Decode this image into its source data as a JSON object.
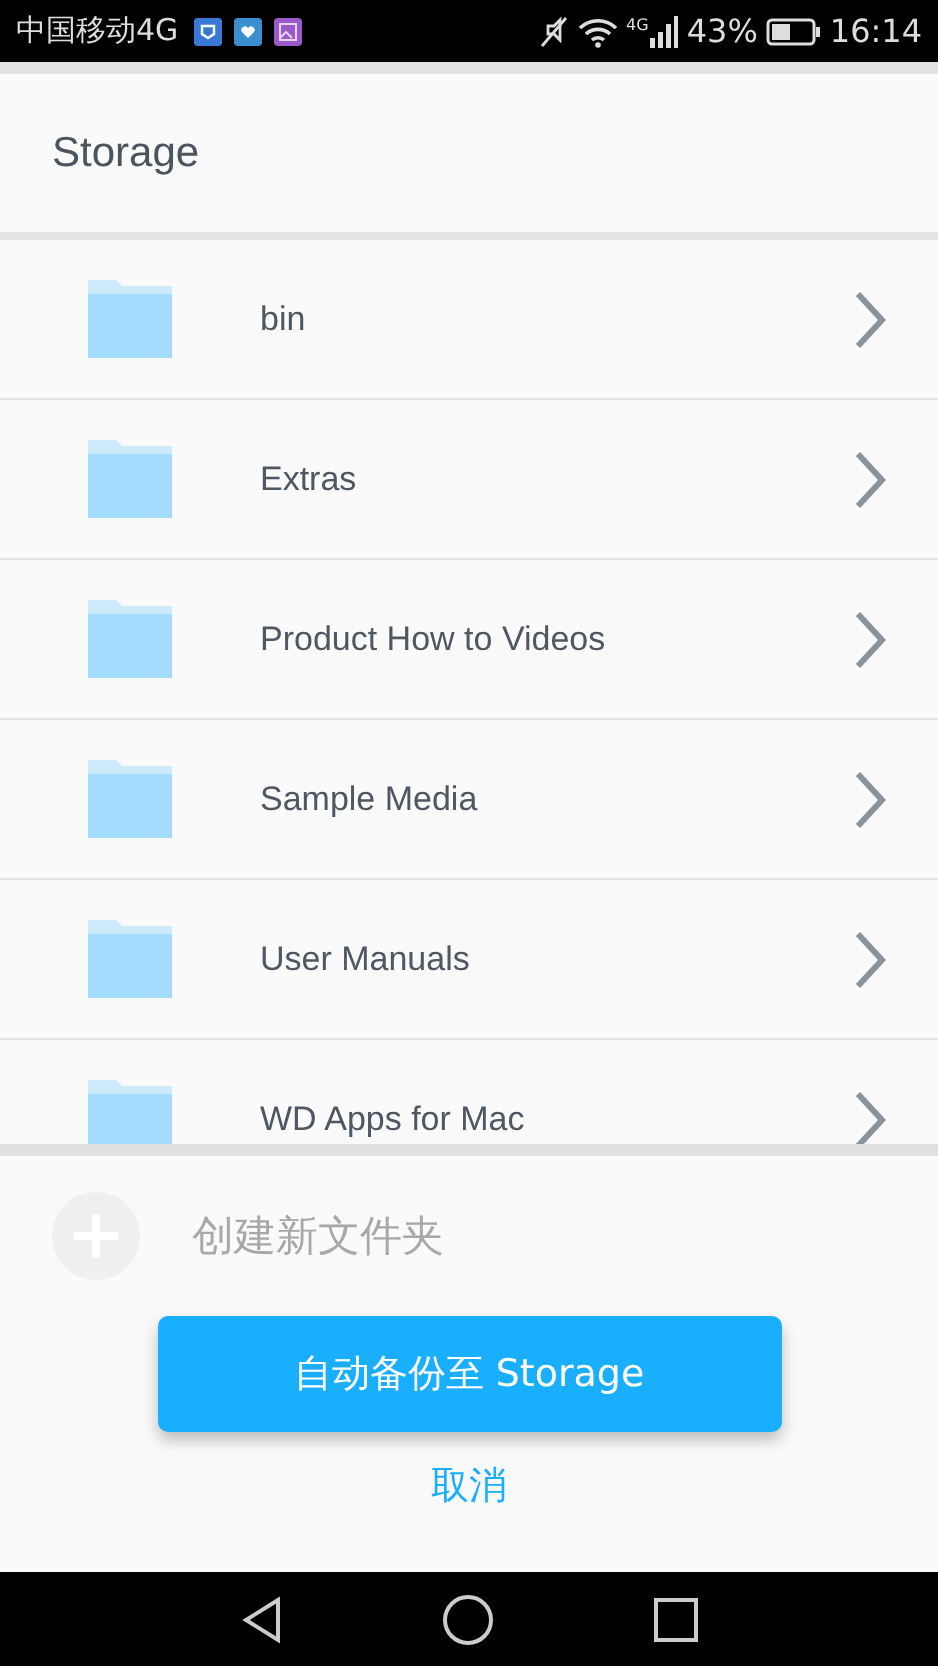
{
  "status_bar": {
    "carrier": "中国移动4G",
    "network_label": "4G",
    "battery": "43%",
    "time": "16:14"
  },
  "header": {
    "title": "Storage"
  },
  "folders": [
    {
      "name": "bin"
    },
    {
      "name": "Extras"
    },
    {
      "name": "Product How to Videos"
    },
    {
      "name": "Sample Media"
    },
    {
      "name": "User Manuals"
    },
    {
      "name": "WD Apps for Mac"
    }
  ],
  "create_folder": {
    "label": "创建新文件夹",
    "disabled": true
  },
  "primary_button": "自动备份至 Storage",
  "cancel_link": "取消"
}
